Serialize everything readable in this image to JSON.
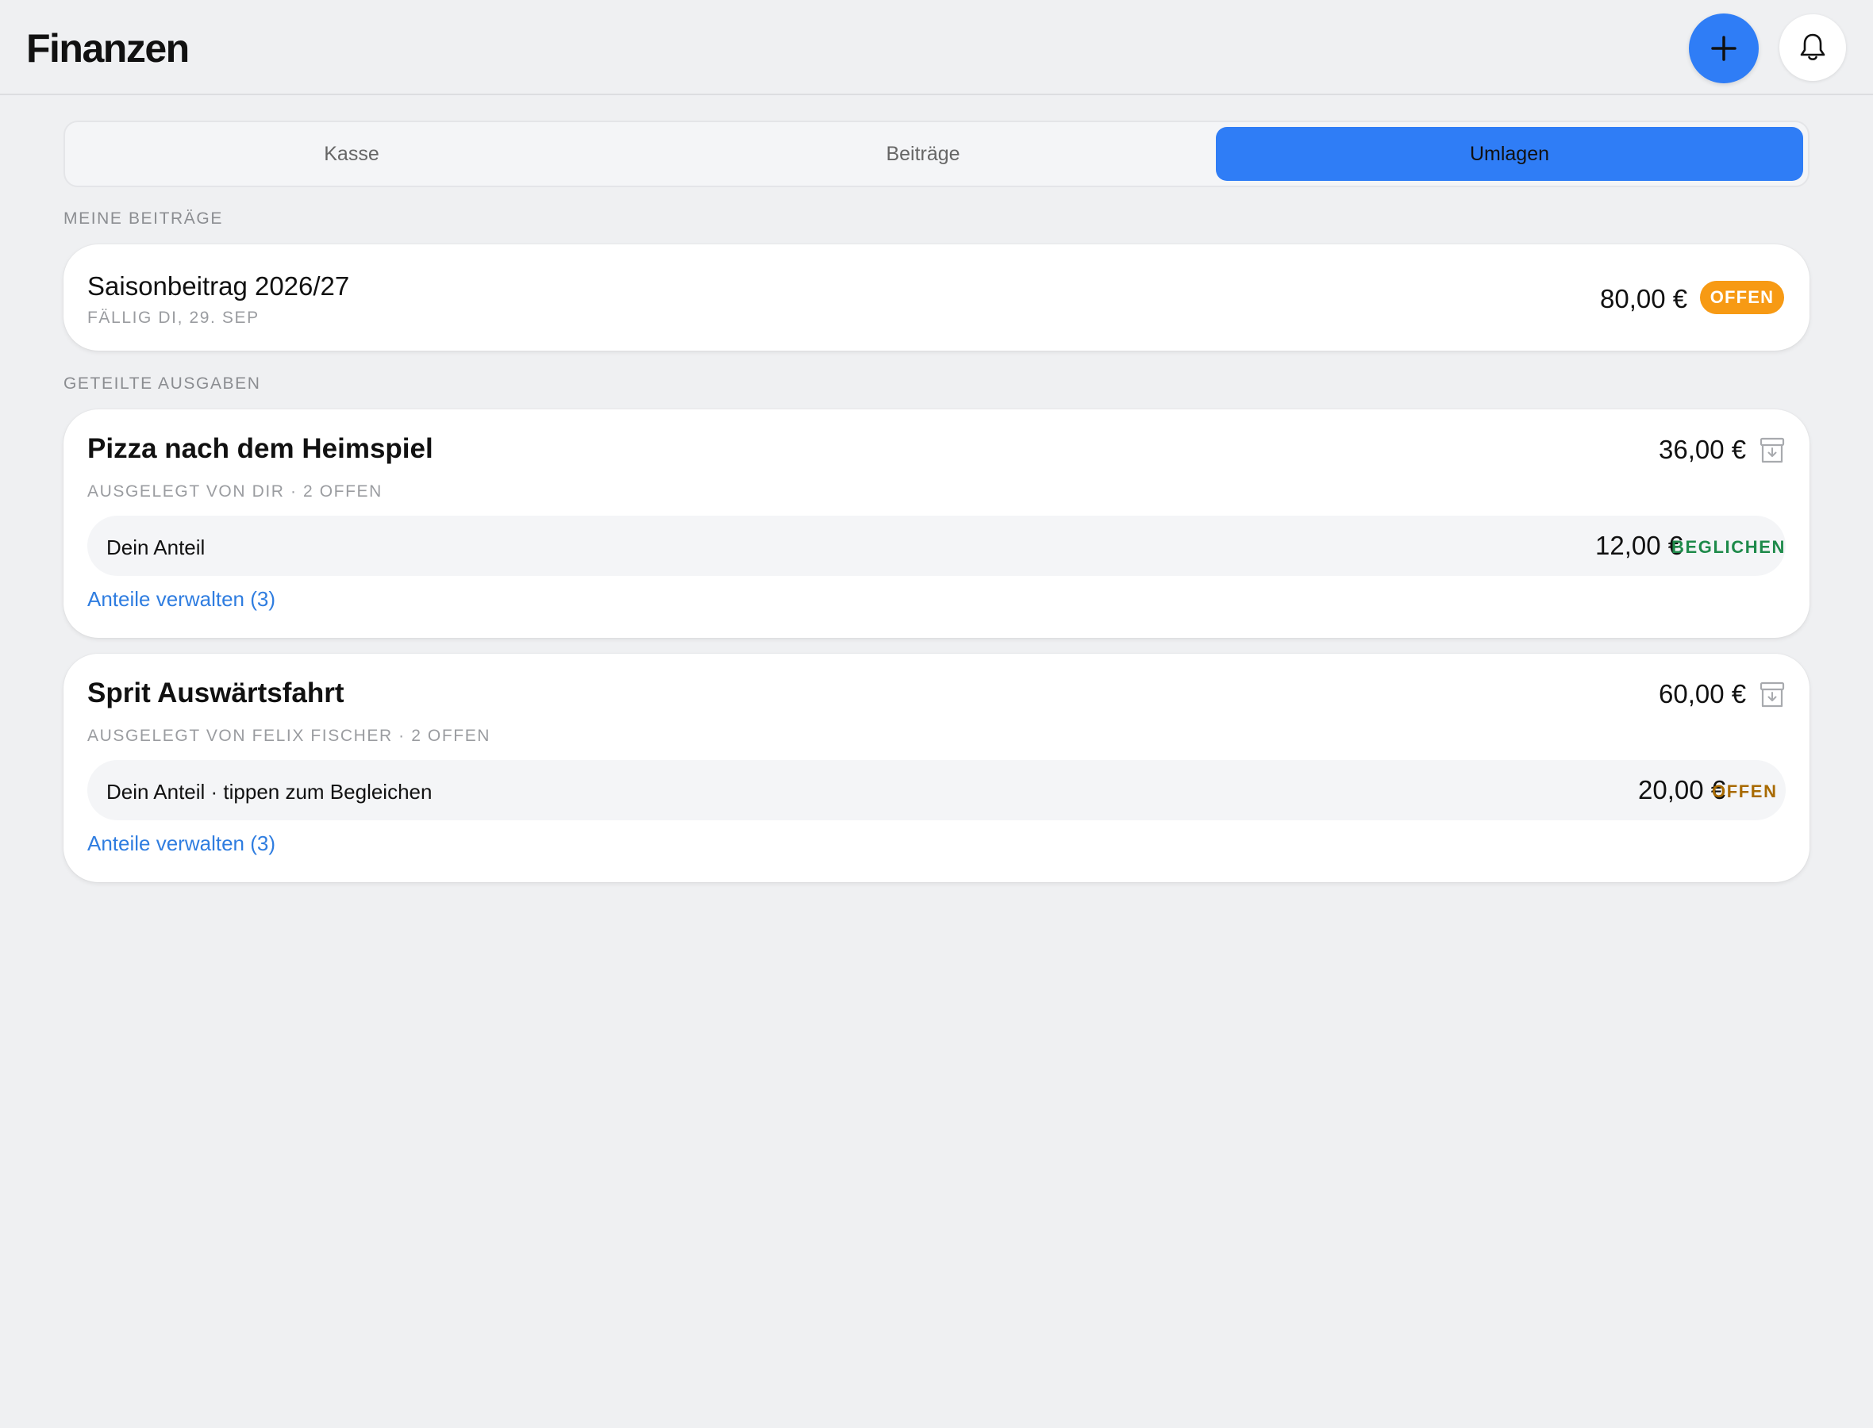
{
  "header": {
    "title": "Finanzen",
    "add_icon": "plus-icon",
    "bell_icon": "bell-icon"
  },
  "tabs": [
    {
      "label": "Kasse",
      "active": false
    },
    {
      "label": "Beiträge",
      "active": false
    },
    {
      "label": "Umlagen",
      "active": true
    }
  ],
  "sections": {
    "my_fees": "MEINE BEITRÄGE",
    "shared": "GETEILTE AUSGABEN"
  },
  "fee": {
    "title": "Saisonbeitrag 2026/27",
    "due": "FÄLLIG DI, 29. SEP",
    "amount": "80,00 €",
    "status": "OFFEN"
  },
  "expenses": [
    {
      "title": "Pizza nach dem Heimspiel",
      "amount": "36,00 €",
      "meta": "AUSGELEGT VON DIR · 2 OFFEN",
      "share_label": "Dein Anteil",
      "share_amount": "12,00 €",
      "share_status": "BEGLICHEN",
      "manage": "Anteile verwalten (3)"
    },
    {
      "title": "Sprit Auswärtsfahrt",
      "amount": "60,00 €",
      "meta": "AUSGELEGT VON FELIX FISCHER · 2 OFFEN",
      "share_label": "Dein Anteil · tippen zum Begleichen",
      "share_amount": "20,00 €",
      "share_status": "OFFEN",
      "manage": "Anteile verwalten (3)"
    }
  ],
  "colors": {
    "accent": "#2f7df6",
    "badge_orange": "#f79a14",
    "status_green": "#1e8a4a",
    "status_brown": "#a86a00",
    "link": "#2f7de0"
  }
}
